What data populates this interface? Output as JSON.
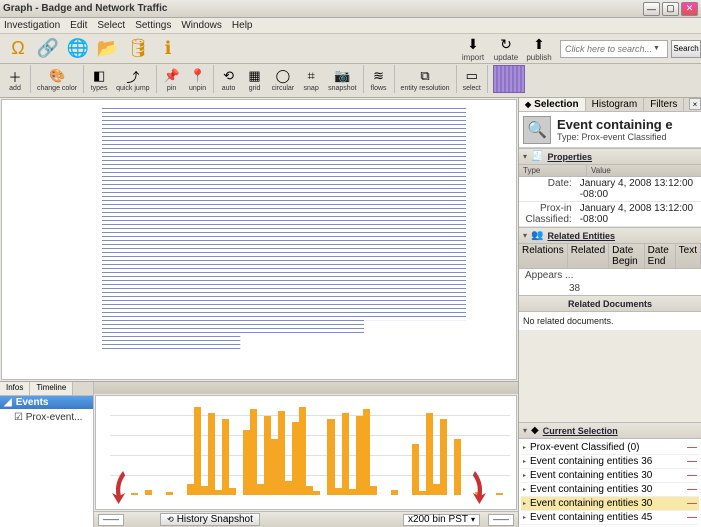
{
  "window": {
    "title": "Graph - Badge and Network Traffic"
  },
  "menu": [
    "Investigation",
    "Edit",
    "Select",
    "Settings",
    "Windows",
    "Help"
  ],
  "main_icons": [
    {
      "name": "omega-icon",
      "glyph": "Ω",
      "color": "#d98a00"
    },
    {
      "name": "link-tool-icon",
      "glyph": "🔗",
      "color": "#3b6fb5"
    },
    {
      "name": "globe-icon",
      "glyph": "🌐",
      "color": "#3b6fb5"
    },
    {
      "name": "folder-icon",
      "glyph": "📂",
      "color": "#e8e0c8"
    },
    {
      "name": "database-icon",
      "glyph": "🛢",
      "color": "#d98a00"
    },
    {
      "name": "info-icon",
      "glyph": "ℹ",
      "color": "#d98a00"
    }
  ],
  "import_group": [
    {
      "name": "import",
      "label": "import",
      "glyph": "⬇"
    },
    {
      "name": "update",
      "label": "update",
      "glyph": "↻"
    },
    {
      "name": "publish",
      "label": "publish",
      "glyph": "⬆"
    }
  ],
  "search": {
    "placeholder": "Click here to search...",
    "button": "Search"
  },
  "toolbar": [
    {
      "name": "add",
      "label": "add",
      "glyph": "＋"
    },
    {
      "name": "change-color",
      "label": "change color",
      "glyph": "🎨"
    },
    {
      "name": "types",
      "label": "types",
      "glyph": "◧"
    },
    {
      "name": "quick-jump",
      "label": "quick jump",
      "glyph": "⤴"
    },
    {
      "name": "pin",
      "label": "pin",
      "glyph": "📌"
    },
    {
      "name": "unpin",
      "label": "unpin",
      "glyph": "📍"
    },
    {
      "name": "auto",
      "label": "auto",
      "glyph": "⟲"
    },
    {
      "name": "grid",
      "label": "grid",
      "glyph": "▦"
    },
    {
      "name": "circular",
      "label": "circular",
      "glyph": "◯"
    },
    {
      "name": "snap",
      "label": "snap",
      "glyph": "⌗"
    },
    {
      "name": "snapshot",
      "label": "snapshot",
      "glyph": "📷"
    },
    {
      "name": "flows",
      "label": "flows",
      "glyph": "≋"
    },
    {
      "name": "entity-resolution",
      "label": "entity resolution",
      "glyph": "⧉"
    },
    {
      "name": "select",
      "label": "select",
      "glyph": "▭"
    }
  ],
  "bottom_tabs": {
    "tab1": "Infos",
    "tab2": "Timeline"
  },
  "events": {
    "header": "Events",
    "item": "Prox-event..."
  },
  "timeline_footer": {
    "history": "History Snapshot",
    "dd1": "——",
    "dd2": "x200 bin PST",
    "dd3": "——"
  },
  "right_tabs": {
    "selection": "Selection",
    "histogram": "Histogram",
    "filters": "Filters"
  },
  "selection": {
    "title": "Event containing e",
    "type_line": "Type: Prox-event Classified"
  },
  "properties": {
    "title": "Properties",
    "col1": "Type",
    "col2": "Value",
    "rows": [
      {
        "k": "Date:",
        "v": "January 4, 2008 13:12:00 -08:00"
      },
      {
        "k": "Prox-in Classified:",
        "v": "January 4, 2008 13:12:00 -08:00"
      }
    ]
  },
  "related_entities": {
    "title": "Related Entities",
    "cols": [
      "Relations",
      "Related",
      "Date Begin",
      "Date End",
      "Text"
    ],
    "row_label": "Appears ...",
    "row_count": "38"
  },
  "related_docs": {
    "title": "Related Documents",
    "body": "No related documents."
  },
  "current_selection": {
    "title": "Current Selection",
    "items": [
      {
        "label": "Prox-event Classified (0)",
        "hl": false
      },
      {
        "label": "Event containing entities 36",
        "hl": false
      },
      {
        "label": "Event containing entities 30",
        "hl": false
      },
      {
        "label": "Event containing entities 30",
        "hl": false
      },
      {
        "label": "Event containing entities 30",
        "hl": true
      },
      {
        "label": "Event containing entities 45",
        "hl": false
      }
    ]
  },
  "chart_data": {
    "type": "bar",
    "title": "",
    "xlabel": "",
    "ylabel": "",
    "ylim": [
      0,
      100
    ],
    "values": [
      0,
      0,
      0,
      2,
      0,
      5,
      0,
      0,
      3,
      0,
      0,
      12,
      95,
      10,
      88,
      5,
      82,
      8,
      0,
      70,
      92,
      12,
      85,
      60,
      90,
      15,
      78,
      95,
      10,
      4,
      0,
      82,
      8,
      88,
      6,
      85,
      92,
      10,
      0,
      0,
      5,
      0,
      0,
      55,
      4,
      88,
      12,
      82,
      0,
      60,
      0,
      0,
      3,
      0,
      0,
      2,
      0
    ]
  }
}
